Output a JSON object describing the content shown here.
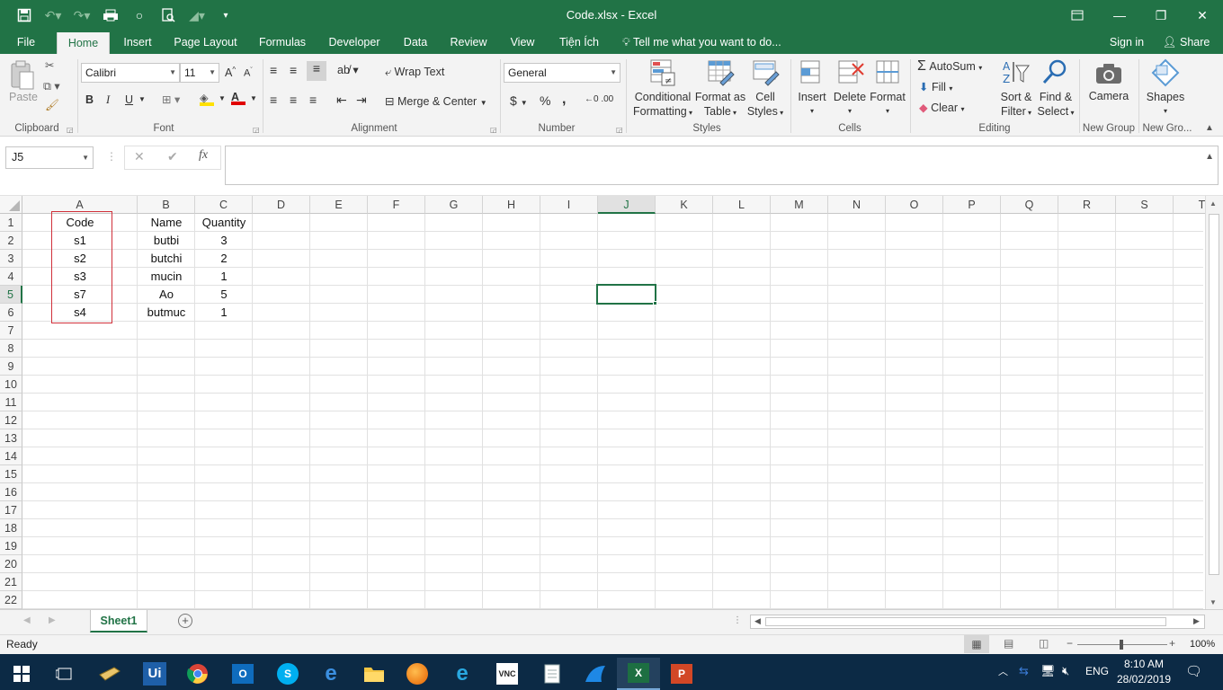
{
  "window": {
    "title": "Code.xlsx - Excel"
  },
  "menu": {
    "tabs": [
      "File",
      "Home",
      "Insert",
      "Page Layout",
      "Formulas",
      "Developer",
      "Data",
      "Review",
      "View",
      "Tiện Ích"
    ],
    "tell_me": "Tell me what you want to do...",
    "sign_in": "Sign in",
    "share": "Share"
  },
  "ribbon": {
    "clipboard": {
      "paste": "Paste",
      "label": "Clipboard"
    },
    "font": {
      "name": "Calibri",
      "size": "11",
      "bold": "B",
      "italic": "I",
      "underline": "U",
      "label": "Font"
    },
    "alignment": {
      "wrap_text": "Wrap Text",
      "merge_center": "Merge & Center",
      "label": "Alignment"
    },
    "number": {
      "format": "General",
      "currency": "$",
      "percent": "%",
      "comma": ",",
      "label": "Number"
    },
    "styles": {
      "conditional": [
        "Conditional",
        "Formatting"
      ],
      "format_table": [
        "Format as",
        "Table"
      ],
      "cell_styles": [
        "Cell",
        "Styles"
      ],
      "label": "Styles"
    },
    "cells": {
      "insert": "Insert",
      "delete": "Delete",
      "format": "Format",
      "label": "Cells"
    },
    "editing": {
      "autosum": "AutoSum",
      "fill": "Fill",
      "clear": "Clear",
      "sort_filter": [
        "Sort &",
        "Filter"
      ],
      "find_select": [
        "Find &",
        "Select"
      ],
      "label": "Editing"
    },
    "new_group": {
      "camera": "Camera",
      "label": "New Group"
    },
    "new_group2": {
      "shapes": "Shapes",
      "label": "New Gro..."
    }
  },
  "formula_bar": {
    "name_box": "J5",
    "formula": ""
  },
  "sheet": {
    "columns": [
      "A",
      "B",
      "C",
      "D",
      "E",
      "F",
      "G",
      "H",
      "I",
      "J",
      "K",
      "L",
      "M",
      "N",
      "O",
      "P",
      "Q",
      "R",
      "S",
      "T"
    ],
    "rows": [
      "1",
      "2",
      "3",
      "4",
      "5",
      "6",
      "7",
      "8",
      "9",
      "10",
      "11",
      "12",
      "13",
      "14",
      "15",
      "16",
      "17",
      "18",
      "19",
      "20",
      "21",
      "22"
    ],
    "data": [
      [
        "Code",
        "Name",
        "Quantity"
      ],
      [
        "s1",
        "butbi",
        "3"
      ],
      [
        "s2",
        "butchi",
        "2"
      ],
      [
        "s3",
        "mucin",
        "1"
      ],
      [
        "s7",
        "Ao",
        "5"
      ],
      [
        "s4",
        "butmuc",
        "1"
      ]
    ],
    "selected_cell": "J5",
    "tab": "Sheet1"
  },
  "status": {
    "ready": "Ready",
    "zoom": "100%"
  },
  "taskbar": {
    "lang": "ENG",
    "time": "8:10 AM",
    "date": "28/02/2019"
  },
  "colors": {
    "excel_green": "#217346",
    "selection_red": "#d0303a",
    "taskbar": "#0c2a45"
  }
}
